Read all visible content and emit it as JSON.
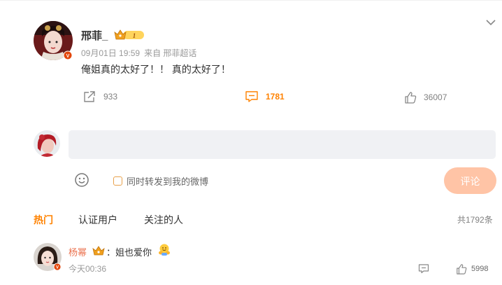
{
  "post": {
    "author": "邢菲_",
    "date": "09月01日 19:59",
    "source": "来自 邢菲超话",
    "text": "俺姐真的太好了！！ 真的太好了！",
    "badge_level": "1",
    "share_count": "933",
    "comment_count": "1781",
    "like_count": "36007"
  },
  "composer": {
    "placeholder": "",
    "repost_label": "同时转发到我的微博",
    "submit_label": "评论"
  },
  "tabs": [
    {
      "label": "热门",
      "active": true
    },
    {
      "label": "认证用户",
      "active": false
    },
    {
      "label": "关注的人",
      "active": false
    }
  ],
  "total_comments": "共1792条",
  "comments": [
    {
      "author": "杨幂",
      "separator": "：",
      "text": "姐也爱你",
      "time": "今天00:36",
      "like_count": "5998"
    }
  ],
  "colors": {
    "accent": "#ff8200",
    "name_link": "#eb7350",
    "submit_disabled": "#ffc4a6",
    "verified": "#e3460a"
  }
}
